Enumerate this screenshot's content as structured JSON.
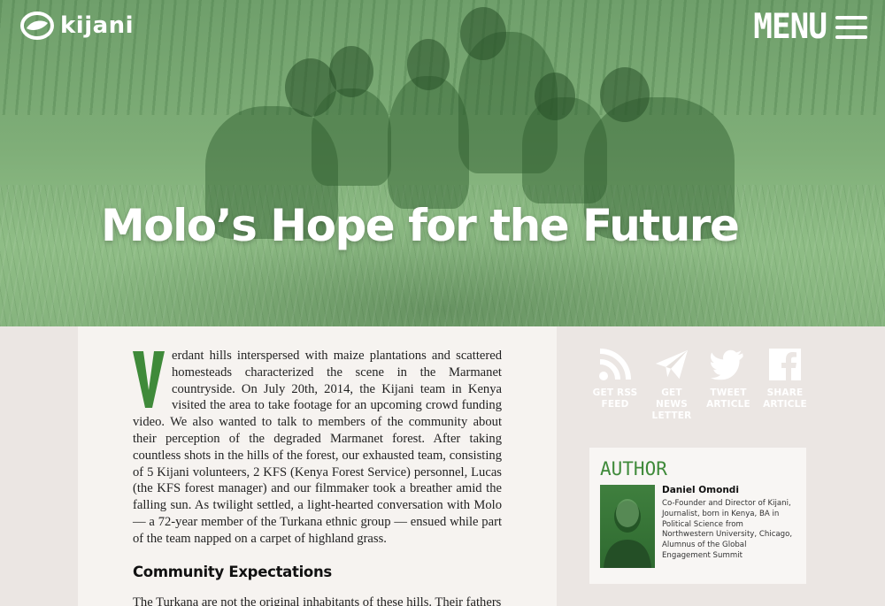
{
  "header": {
    "logo_text": "kijani",
    "menu_label": "MENU"
  },
  "hero": {
    "title": "Molo’s Hope for the Future"
  },
  "article": {
    "dropcap": "V",
    "paragraph1_rest": "erdant hills interspersed with maize plantations and scattered homesteads characterized the scene in the Marmanet countryside. On July 20th, 2014, the Kijani team in Kenya visited the area to take footage for an upcoming crowd funding video. We also wanted to talk to members of the community about their perception of the degraded Marmanet forest. After taking countless shots in the hills of the forest, our exhausted team, consisting of 5 Kijani volunteers, 2 KFS (Kenya Forest Service) personnel, Lucas (the KFS forest manager) and our filmmaker took a breather amid the falling sun. As twilight settled, a light-hearted conversation with Molo — a 72-year member of the Turkana ethnic group — ensued while part of the team napped on a carpet of highland grass.",
    "section_heading": "Community Expectations",
    "paragraph2": "The Turkana are not the original inhabitants of these hills. Their fathers"
  },
  "share": [
    {
      "label": "GET RSS\nFEED",
      "icon": "rss-icon"
    },
    {
      "label": "GET NEWS\nLETTER",
      "icon": "paper-plane-icon"
    },
    {
      "label": "TWEET\nARTICLE",
      "icon": "twitter-icon"
    },
    {
      "label": "SHARE\nARTICLE",
      "icon": "facebook-icon"
    }
  ],
  "author": {
    "heading": "AUTHOR",
    "name": "Daniel Omondi",
    "bio": "Co-Founder and Director of Kijani, Journalist, born in Kenya, BA in Political Science from Northwestern University, Chicago, Alumnus of the Global Engagement Summit"
  },
  "colors": {
    "brand_green": "#3f8a3a",
    "hero_tint": "#7fae78",
    "page_bg": "#ebe6e3",
    "article_bg": "#f6f3f0"
  }
}
